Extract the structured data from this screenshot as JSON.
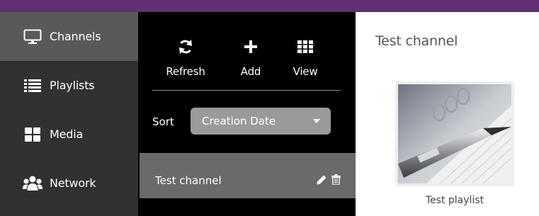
{
  "colors": {
    "brand": "#612f72",
    "sidebar": "#313131",
    "sidebar_active": "#595959",
    "panel": "#000000",
    "select": "#9a9a9a",
    "row_selected": "#6a6a6a"
  },
  "sidebar": {
    "items": [
      {
        "label": "Channels",
        "icon": "monitor-icon",
        "active": true
      },
      {
        "label": "Playlists",
        "icon": "list-icon",
        "active": false
      },
      {
        "label": "Media",
        "icon": "grid-icon",
        "active": false
      },
      {
        "label": "Network",
        "icon": "users-icon",
        "active": false
      }
    ]
  },
  "toolbar": {
    "refresh_label": "Refresh",
    "add_label": "Add",
    "view_label": "View"
  },
  "sort": {
    "label": "Sort",
    "selected": "Creation Date"
  },
  "channels": [
    {
      "name": "Test channel",
      "selected": true
    }
  ],
  "content": {
    "title": "Test channel",
    "playlist": {
      "name": "Test playlist",
      "thumbnail": "pen-and-notebook-photo"
    }
  }
}
